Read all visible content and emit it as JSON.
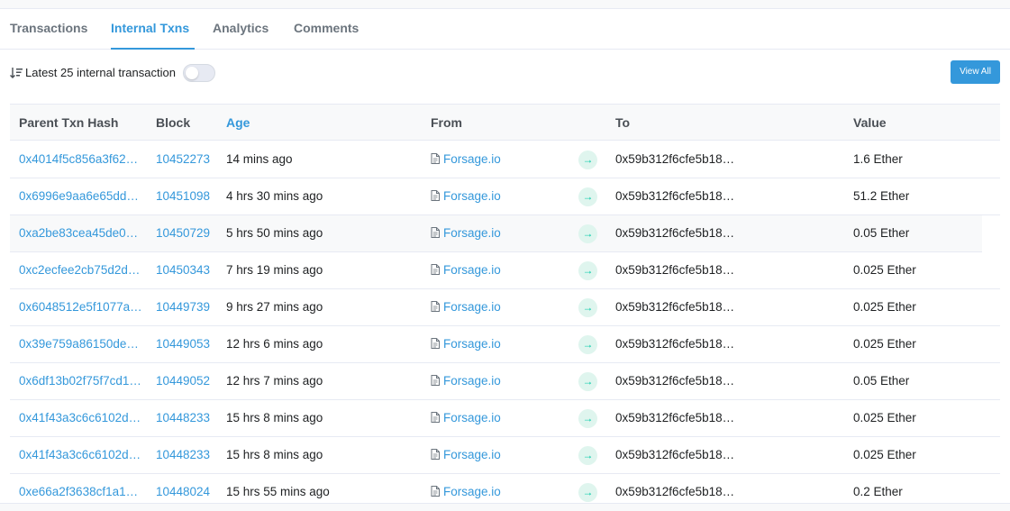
{
  "tabs": [
    {
      "label": "Transactions"
    },
    {
      "label": "Internal Txns"
    },
    {
      "label": "Analytics"
    },
    {
      "label": "Comments"
    }
  ],
  "toolbar": {
    "latest_label": "Latest 25 internal transaction",
    "view_all_label": "View All",
    "toggle_on": false
  },
  "table": {
    "headers": {
      "parent_txn_hash": "Parent Txn Hash",
      "block": "Block",
      "age": "Age",
      "from": "From",
      "to": "To",
      "value": "Value"
    },
    "rows": [
      {
        "hash": "0x4014f5c856a3f62…",
        "block": "10452273",
        "age": "14 mins ago",
        "from": "Forsage.io",
        "to": "0x59b312f6cfe5b18…",
        "value": "1.6 Ether"
      },
      {
        "hash": "0x6996e9aa6e65dd…",
        "block": "10451098",
        "age": "4 hrs 30 mins ago",
        "from": "Forsage.io",
        "to": "0x59b312f6cfe5b18…",
        "value": "51.2 Ether"
      },
      {
        "hash": "0xa2be83cea45de0…",
        "block": "10450729",
        "age": "5 hrs 50 mins ago",
        "from": "Forsage.io",
        "to": "0x59b312f6cfe5b18…",
        "value": "0.05 Ether"
      },
      {
        "hash": "0xc2ecfee2cb75d2d…",
        "block": "10450343",
        "age": "7 hrs 19 mins ago",
        "from": "Forsage.io",
        "to": "0x59b312f6cfe5b18…",
        "value": "0.025 Ether"
      },
      {
        "hash": "0x6048512e5f1077a…",
        "block": "10449739",
        "age": "9 hrs 27 mins ago",
        "from": "Forsage.io",
        "to": "0x59b312f6cfe5b18…",
        "value": "0.025 Ether"
      },
      {
        "hash": "0x39e759a86150de…",
        "block": "10449053",
        "age": "12 hrs 6 mins ago",
        "from": "Forsage.io",
        "to": "0x59b312f6cfe5b18…",
        "value": "0.025 Ether"
      },
      {
        "hash": "0x6df13b02f75f7cd1…",
        "block": "10449052",
        "age": "12 hrs 7 mins ago",
        "from": "Forsage.io",
        "to": "0x59b312f6cfe5b18…",
        "value": "0.05 Ether"
      },
      {
        "hash": "0x41f43a3c6c6102d…",
        "block": "10448233",
        "age": "15 hrs 8 mins ago",
        "from": "Forsage.io",
        "to": "0x59b312f6cfe5b18…",
        "value": "0.025 Ether"
      },
      {
        "hash": "0x41f43a3c6c6102d…",
        "block": "10448233",
        "age": "15 hrs 8 mins ago",
        "from": "Forsage.io",
        "to": "0x59b312f6cfe5b18…",
        "value": "0.025 Ether"
      },
      {
        "hash": "0xe66a2f3638cf1a1…",
        "block": "10448024",
        "age": "15 hrs 55 mins ago",
        "from": "Forsage.io",
        "to": "0x59b312f6cfe5b18…",
        "value": "0.2 Ether"
      }
    ],
    "highlighted_row": 2
  },
  "icons": {
    "sort": "sort-descending-icon",
    "from_doc": "document-icon",
    "transfer": "arrow-right-icon"
  },
  "colors": {
    "accent": "#3498db",
    "arrow": "#00c9a7",
    "arrow_bg": "#dff5ee"
  }
}
